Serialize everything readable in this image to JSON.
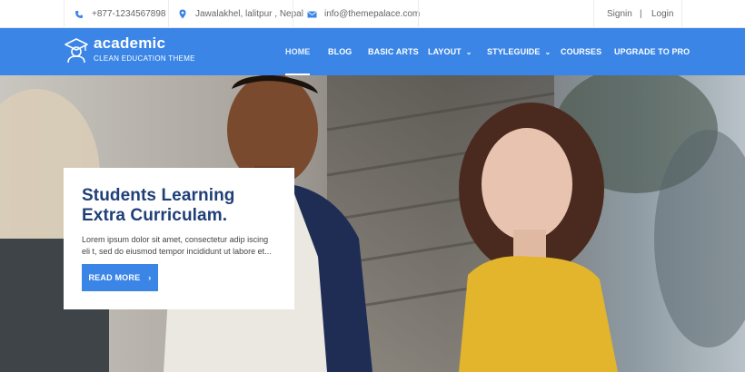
{
  "topbar": {
    "phone": "+877-1234567898",
    "address": "Jawalakhel, lalitpur , Nepal",
    "email": "info@themepalace.com",
    "signin": "Signin",
    "divider": "|",
    "login": "Login"
  },
  "logo": {
    "name": "academic",
    "tagline": "CLEAN EDUCATION THEME"
  },
  "nav": {
    "items": [
      {
        "label": "HOME",
        "dropdown": false,
        "active": true
      },
      {
        "label": "BLOG",
        "dropdown": false
      },
      {
        "label": "BASIC ARTS",
        "dropdown": false
      },
      {
        "label": "LAYOUT",
        "dropdown": true
      },
      {
        "label": "STYLEGUIDE",
        "dropdown": true
      },
      {
        "label": "COURSES",
        "dropdown": false
      },
      {
        "label": "UPGRADE TO PRO",
        "dropdown": false
      }
    ]
  },
  "hero": {
    "title_line1": "Students Learning",
    "title_line2": "Extra Curriculam.",
    "excerpt": "Lorem ipsum dolor sit amet, consectetur adip iscing eli t, sed do eiusmod tempor incididunt ut labore et...",
    "button": "READ MORE",
    "button_arrow": "›"
  },
  "icons": {
    "phone": "phone-icon",
    "address": "map-pin-icon",
    "email": "envelope-icon",
    "logo": "graduate-icon",
    "dropdown": "chevron-down-icon",
    "arrow": "chevron-right-icon"
  },
  "colors": {
    "brand_blue": "#3a85e6",
    "title_navy": "#1f3f78",
    "text_gray": "#666666"
  }
}
